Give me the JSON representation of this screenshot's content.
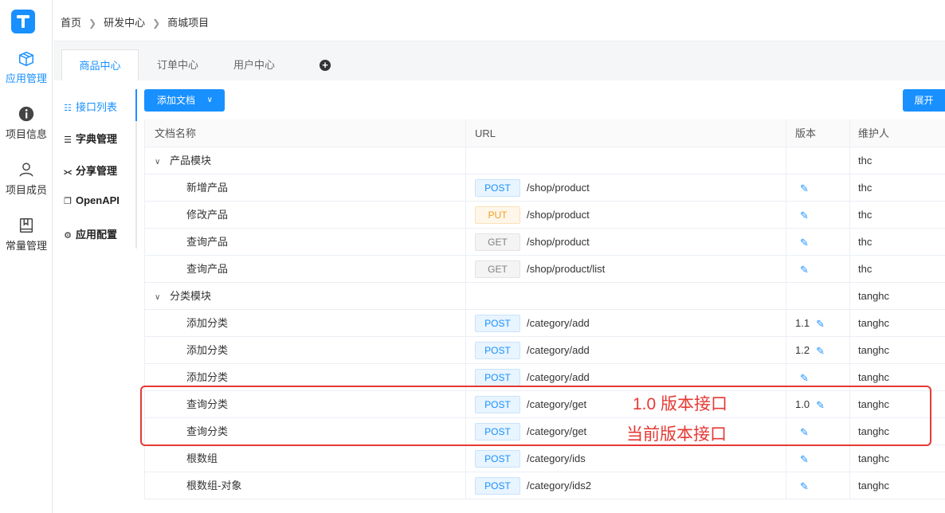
{
  "nav": {
    "items": [
      {
        "label": "应用管理",
        "icon": "box-icon",
        "active": true
      },
      {
        "label": "项目信息",
        "icon": "info-icon"
      },
      {
        "label": "项目成员",
        "icon": "user-icon"
      },
      {
        "label": "常量管理",
        "icon": "book-icon"
      }
    ]
  },
  "breadcrumb": [
    "首页",
    "研发中心",
    "商城项目"
  ],
  "tabs": [
    "商品中心",
    "订单中心",
    "用户中心"
  ],
  "tab_add": "+",
  "subnav": [
    {
      "label": "接口列表",
      "icon": "grid-icon",
      "active": true
    },
    {
      "label": "字典管理",
      "icon": "doc-icon"
    },
    {
      "label": "分享管理",
      "icon": "share-icon"
    },
    {
      "label": "OpenAPI",
      "icon": "bookmark-icon"
    },
    {
      "label": "应用配置",
      "icon": "gear-icon"
    }
  ],
  "toolbar": {
    "add_doc": "添加文档",
    "expand": "展开"
  },
  "table": {
    "headers": [
      "文档名称",
      "URL",
      "版本",
      "维护人"
    ],
    "rows": [
      {
        "type": "folder",
        "name": "产品模块",
        "maintainer": "thc"
      },
      {
        "type": "child",
        "name": "新增产品",
        "method": "POST",
        "url": "/shop/product",
        "version": "",
        "maintainer": "thc"
      },
      {
        "type": "child",
        "name": "修改产品",
        "method": "PUT",
        "url": "/shop/product",
        "version": "",
        "maintainer": "thc"
      },
      {
        "type": "child",
        "name": "查询产品",
        "method": "GET",
        "url": "/shop/product",
        "version": "",
        "maintainer": "thc"
      },
      {
        "type": "child",
        "name": "查询产品",
        "method": "GET",
        "url": "/shop/product/list",
        "version": "",
        "maintainer": "thc"
      },
      {
        "type": "folder",
        "name": "分类模块",
        "maintainer": "tanghc"
      },
      {
        "type": "child",
        "name": "添加分类",
        "method": "POST",
        "url": "/category/add",
        "version": "1.1",
        "maintainer": "tanghc"
      },
      {
        "type": "child",
        "name": "添加分类",
        "method": "POST",
        "url": "/category/add",
        "version": "1.2",
        "maintainer": "tanghc"
      },
      {
        "type": "child",
        "name": "添加分类",
        "method": "POST",
        "url": "/category/add",
        "version": "",
        "maintainer": "tanghc"
      },
      {
        "type": "child",
        "name": "查询分类",
        "method": "POST",
        "url": "/category/get",
        "version": "1.0",
        "maintainer": "tanghc"
      },
      {
        "type": "child",
        "name": "查询分类",
        "method": "POST",
        "url": "/category/get",
        "version": "",
        "maintainer": "tanghc"
      },
      {
        "type": "child",
        "name": "根数组",
        "method": "POST",
        "url": "/category/ids",
        "version": "",
        "maintainer": "tanghc"
      },
      {
        "type": "child",
        "name": "根数组-对象",
        "method": "POST",
        "url": "/category/ids2",
        "version": "",
        "maintainer": "tanghc"
      }
    ]
  },
  "annotations": {
    "first": "1.0 版本接口",
    "second": "当前版本接口"
  },
  "colors": {
    "accent": "#1890ff",
    "annotation": "#e53935",
    "put": "#f0a020",
    "get": "#808080"
  }
}
